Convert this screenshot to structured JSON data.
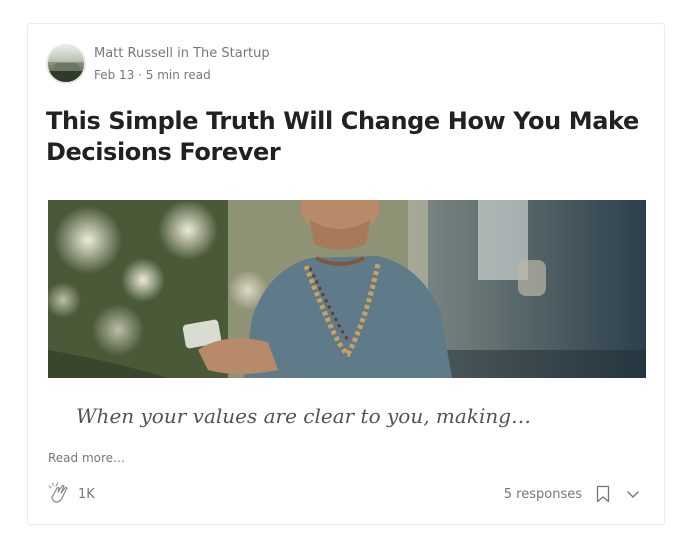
{
  "post": {
    "author_line": "Matt Russell in The Startup",
    "date_line": "Feb 13 · 5 min read",
    "title": "This Simple Truth Will Change How You Make Decisions Forever",
    "subtitle": "When your values are clear to you, making…",
    "read_more": "Read more…"
  },
  "footer": {
    "clap_count": "1K",
    "responses": "5 responses"
  },
  "icons": {
    "clap": "clap-icon",
    "bookmark": "bookmark-icon",
    "chevron": "chevron-down-icon"
  },
  "colors": {
    "muted_text": "#757575",
    "title_text": "#212121",
    "border": "#ececec"
  }
}
